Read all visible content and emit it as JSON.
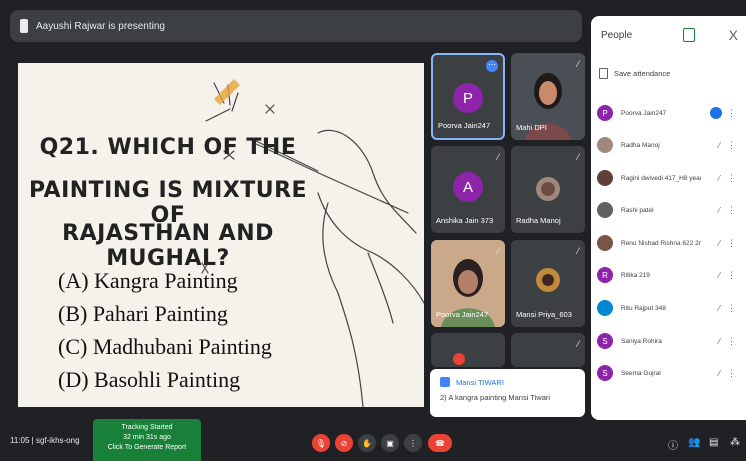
{
  "presenter_banner": "Aayushi Rajwar is presenting",
  "slide": {
    "question_lines": [
      "Q21. WHICH OF THE",
      "PAINTING IS MIXTURE OF",
      "RAJASTHAN AND MUGHAL?"
    ],
    "options": [
      "(A) Kangra Painting",
      "(B) Pahari Painting",
      "(C) Madhubani Painting",
      "(D) Basohli Painting"
    ]
  },
  "tiles": [
    {
      "name": "Poorva Jain247",
      "initial": "P",
      "color": "#8e24aa"
    },
    {
      "name": "Mahi DPI",
      "initial": "",
      "color": ""
    },
    {
      "name": "Anshika Jain 373",
      "initial": "A",
      "color": "#8e24aa"
    },
    {
      "name": "Radha Manoj",
      "initial": "",
      "color": ""
    },
    {
      "name": "Poorva Jain247",
      "initial": "",
      "color": ""
    },
    {
      "name": "Mansi Priya_603",
      "initial": "",
      "color": ""
    }
  ],
  "caption": {
    "speaker": "Mansi TIWARI",
    "text": "2) A kangra painting Mansi Tiwari"
  },
  "people_panel": {
    "title": "People",
    "close_glyph": "X",
    "save_attendance": "Save attendance",
    "people": [
      {
        "name": "Poorva Jain247",
        "initial": "P",
        "color": "#8e24aa"
      },
      {
        "name": "Radha Manoj",
        "initial": "",
        "color": "#a1887f"
      },
      {
        "name": "Ragini dwivedi 417_H8 year",
        "initial": "",
        "color": "#5d4037"
      },
      {
        "name": "Rashi patel",
        "initial": "",
        "color": "#616161"
      },
      {
        "name": "Renu Nishad Rishna 622 2n...",
        "initial": "",
        "color": "#795548"
      },
      {
        "name": "Ritika 219",
        "initial": "R",
        "color": "#8e24aa"
      },
      {
        "name": "Ritu Rajput 348",
        "initial": "",
        "color": "#0288d1"
      },
      {
        "name": "Saniya Rohira",
        "initial": "S",
        "color": "#8e24aa"
      },
      {
        "name": "Seema Gujral",
        "initial": "S",
        "color": "#8e24aa"
      }
    ]
  },
  "bottom_bar": {
    "meeting_info": "11:05 | sgf-ikhs-ong",
    "tracking": [
      "Tracking Started",
      "32 min 31s ago",
      "Click To Generate Report"
    ]
  }
}
